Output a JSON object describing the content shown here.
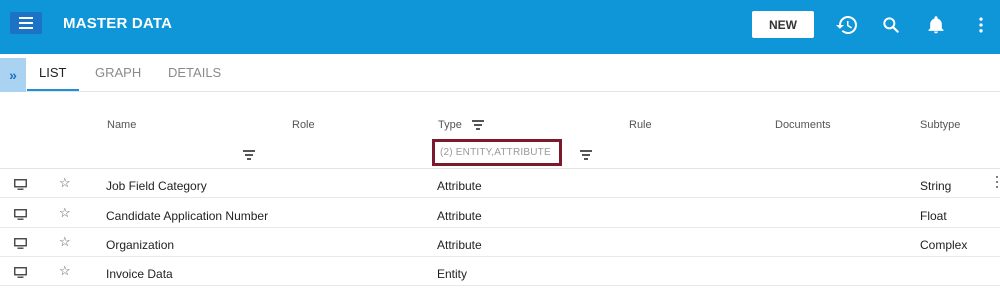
{
  "header": {
    "title": "MASTER DATA",
    "new_label": "NEW",
    "colors": {
      "bar": "#0f96d8",
      "menu_button": "#1a73c4"
    },
    "icons": [
      "menu-icon",
      "history-icon",
      "search-icon",
      "bell-icon",
      "more-vert-icon"
    ]
  },
  "tabs": [
    {
      "label": "LIST",
      "active": true
    },
    {
      "label": "GRAPH",
      "active": false
    },
    {
      "label": "DETAILS",
      "active": false
    }
  ],
  "expand_label": "»",
  "table": {
    "columns": [
      "Name",
      "Role",
      "Type",
      "Rule",
      "Documents",
      "Subtype"
    ],
    "type_filter_value": "(2) ENTITY,ATTRIBUTE",
    "rows": [
      {
        "name": "Job Field Category",
        "type": "Attribute",
        "subtype": "String"
      },
      {
        "name": "Candidate Application Number",
        "type": "Attribute",
        "subtype": "Float"
      },
      {
        "name": "Organization",
        "type": "Attribute",
        "subtype": "Complex"
      },
      {
        "name": "Invoice Data",
        "type": "Entity",
        "subtype": ""
      }
    ]
  },
  "highlight_color": "#7a1a2a"
}
